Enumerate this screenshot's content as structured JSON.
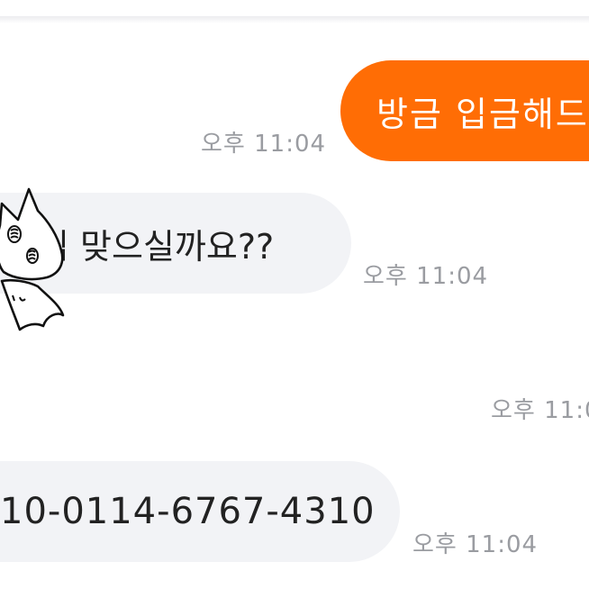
{
  "chat": {
    "messages": [
      {
        "direction": "outgoing",
        "text": "방금 입금해드"
      },
      {
        "direction": "incoming",
        "text": "님 맞으실까요??"
      },
      {
        "direction": "incoming",
        "text": "10-0114-6767-4310"
      }
    ],
    "times": [
      "오후 11:04",
      "오후 11:04",
      "오후 11:0",
      "오후 11:04"
    ]
  },
  "colors": {
    "outgoing_bubble": "#ff6d05",
    "incoming_bubble": "#f2f3f6",
    "timestamp": "#9a9ca1"
  },
  "icons": [
    "cat-sticker-icon"
  ]
}
